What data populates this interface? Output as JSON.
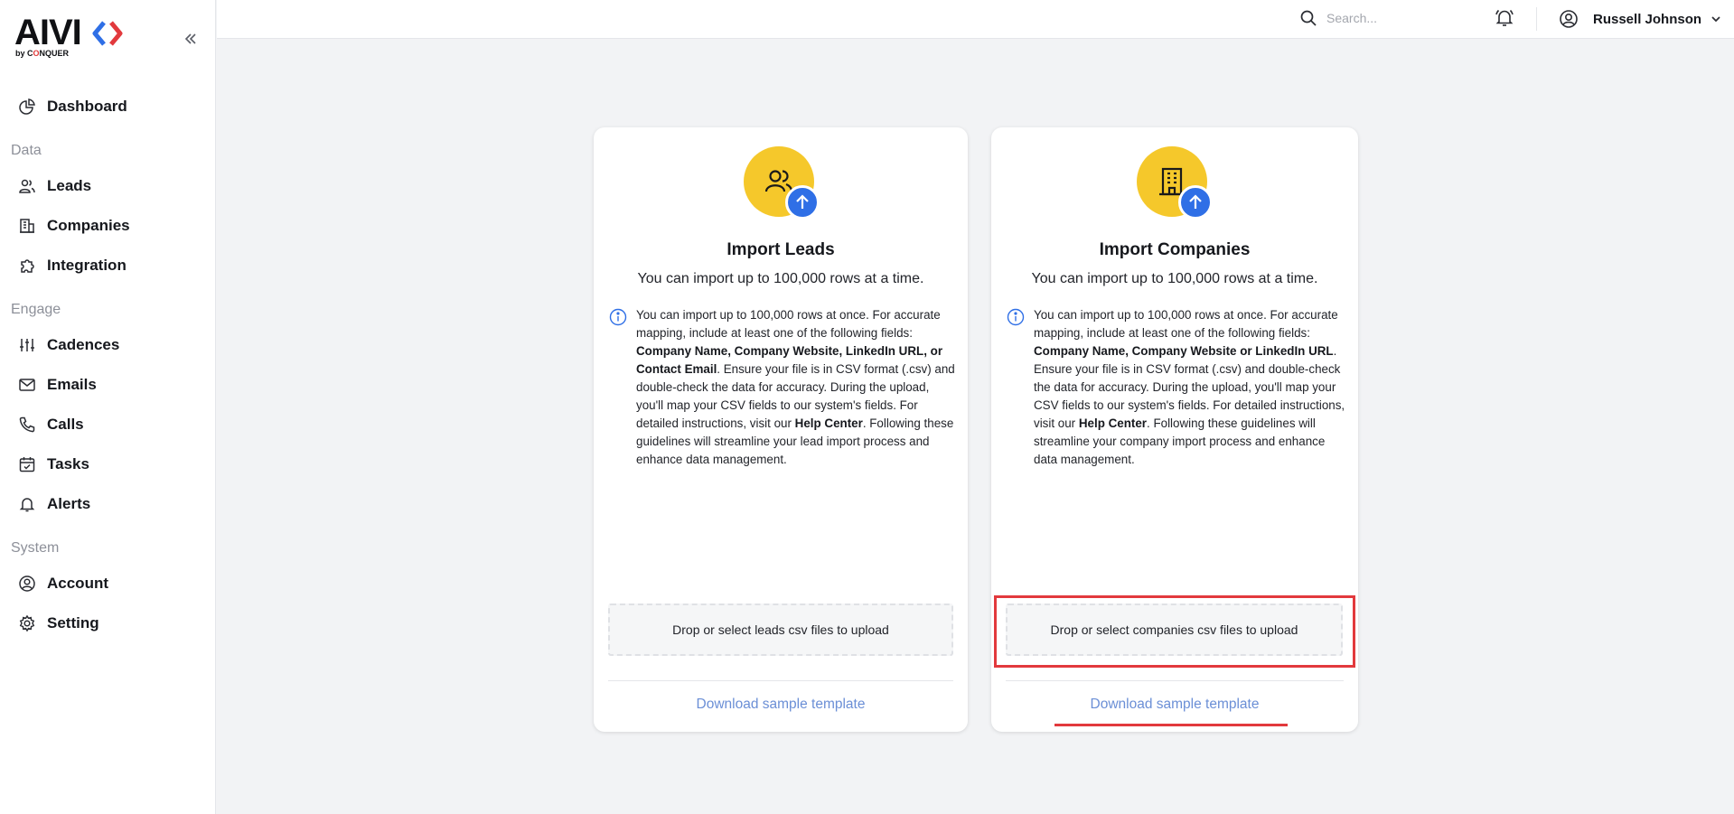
{
  "brand": {
    "logo_text": "AIVI",
    "logo_sub_prefix": "by C",
    "logo_sub_accent": "O",
    "logo_sub_suffix": "NQUER"
  },
  "sidebar": {
    "collapse_icon": "double-chevron-left-icon",
    "items": [
      {
        "label": "Dashboard",
        "icon": "pie-chart-icon"
      },
      {
        "section": "Data"
      },
      {
        "label": "Leads",
        "icon": "users-icon"
      },
      {
        "label": "Companies",
        "icon": "building-icon"
      },
      {
        "label": "Integration",
        "icon": "puzzle-icon"
      },
      {
        "section": "Engage"
      },
      {
        "label": "Cadences",
        "icon": "sliders-icon"
      },
      {
        "label": "Emails",
        "icon": "mail-icon"
      },
      {
        "label": "Calls",
        "icon": "phone-icon"
      },
      {
        "label": "Tasks",
        "icon": "calendar-check-icon"
      },
      {
        "label": "Alerts",
        "icon": "bell-icon"
      },
      {
        "section": "System"
      },
      {
        "label": "Account",
        "icon": "user-circle-icon"
      },
      {
        "label": "Setting",
        "icon": "gear-icon"
      }
    ]
  },
  "header": {
    "search_placeholder": "Search...",
    "user_name": "Russell Johnson"
  },
  "cards": [
    {
      "title": "Import Leads",
      "subtitle": "You can import up to 100,000 rows at a time.",
      "info": {
        "t1": "You can import up to 100,000 rows at once. For accurate mapping, include at least one of the following fields: ",
        "b1": "Company Name, Company Website, LinkedIn URL, or Contact Email",
        "t2": ". Ensure your file is in CSV format (.csv) and double-check the data for accuracy. During the upload, you'll map your CSV fields to our system's fields. For detailed instructions, visit our ",
        "b2": "Help Center",
        "t3": ". Following these guidelines will streamline your lead import process and enhance data management."
      },
      "dropzone": "Drop or select leads csv files to upload",
      "download": "Download sample template"
    },
    {
      "title": "Import Companies",
      "subtitle": "You can import up to 100,000 rows at a time.",
      "info": {
        "t1": "You can import up to 100,000 rows at once. For accurate mapping, include at least one of the following fields: ",
        "b1": "Company Name, Company Website or LinkedIn URL",
        "t2": ". Ensure your file is in CSV format (.csv) and double-check the data for accuracy. During the upload, you'll map your CSV fields to our system's fields. For detailed instructions, visit our ",
        "b2": "Help Center",
        "t3": ". Following these guidelines will streamline your company import process and enhance data management."
      },
      "dropzone": "Drop or select companies csv files to upload",
      "download": "Download sample template"
    }
  ],
  "colors": {
    "accent_yellow": "#f5c82b",
    "accent_blue": "#2f6fe6",
    "highlight_red": "#e2393d",
    "link": "#6b8fd6"
  }
}
